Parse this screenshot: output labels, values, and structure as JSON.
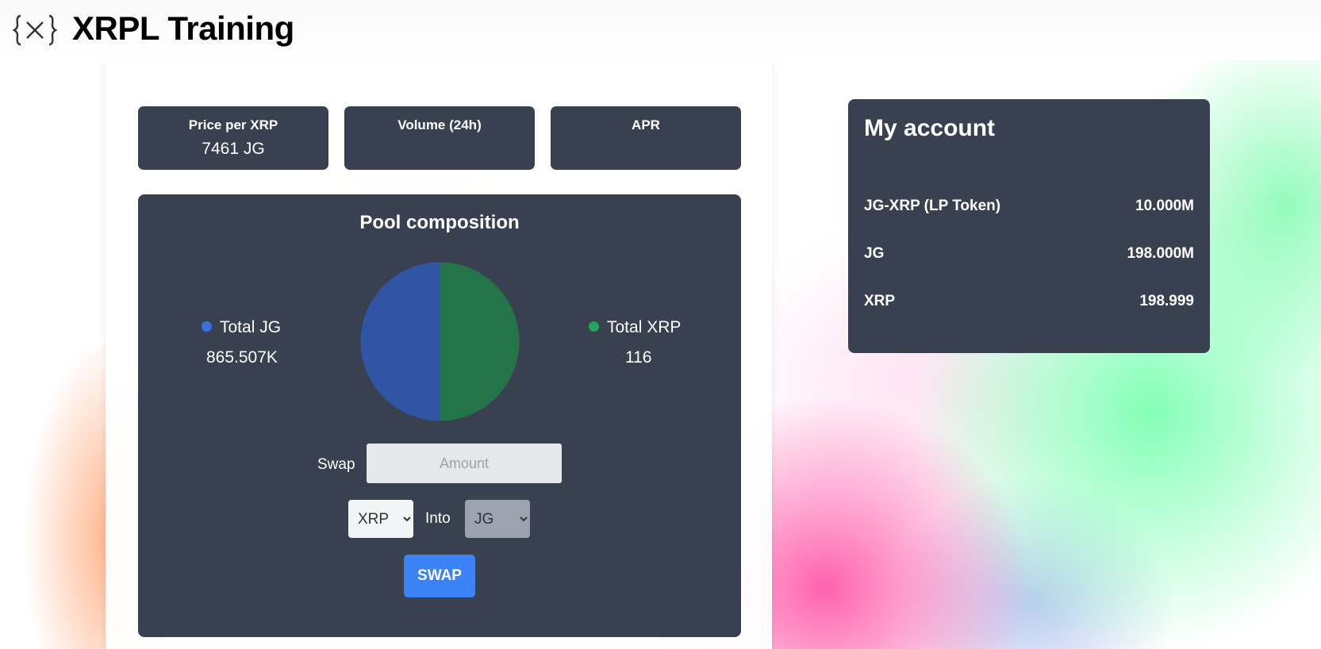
{
  "header": {
    "brand": "XRPL Training",
    "logo_icon": "curly-braces-x-icon"
  },
  "stats": [
    {
      "title": "Price per XRP",
      "value": "7461 JG"
    },
    {
      "title": "Volume (24h)",
      "value": ""
    },
    {
      "title": "APR",
      "value": ""
    }
  ],
  "pool": {
    "title": "Pool composition",
    "legend": [
      {
        "label": "Total JG",
        "value": "865.507K",
        "color": "#2f55a4"
      },
      {
        "label": "Total XRP",
        "value": "116",
        "color": "#24744a"
      }
    ],
    "chart_data": {
      "type": "pie",
      "slices": [
        {
          "name": "Total JG",
          "value": 50,
          "color": "#2f55a4"
        },
        {
          "name": "Total XRP",
          "value": 50,
          "color": "#24744a"
        }
      ]
    },
    "swap_label": "Swap",
    "amount_placeholder": "Amount",
    "from_selected": "XRP",
    "into_label": "Into",
    "to_selected": "JG",
    "swap_button": "SWAP"
  },
  "account": {
    "title": "My account",
    "rows": [
      {
        "label": "JG-XRP (LP Token)",
        "value": "10.000M"
      },
      {
        "label": "JG",
        "value": "198.000M"
      },
      {
        "label": "XRP",
        "value": "198.999"
      }
    ]
  },
  "colors": {
    "card": "#394150",
    "accent": "#3b82f6",
    "legend_jg_dot": "#3b6fe0",
    "legend_xrp_dot": "#22a55a"
  }
}
